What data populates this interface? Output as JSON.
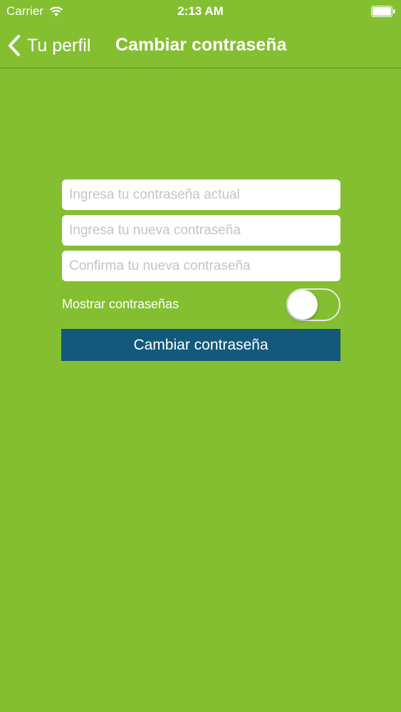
{
  "status_bar": {
    "carrier": "Carrier",
    "time": "2:13 AM",
    "wifi_icon": "wifi-icon",
    "battery_icon": "battery-icon"
  },
  "nav": {
    "back_label": "Tu perfil",
    "back_icon": "chevron-left-icon",
    "title": "Cambiar contraseña"
  },
  "form": {
    "current_password_placeholder": "Ingresa tu contraseña actual",
    "current_password_value": "",
    "new_password_placeholder": "Ingresa tu nueva contraseña",
    "new_password_value": "",
    "confirm_password_placeholder": "Confirma tu nueva contraseña",
    "confirm_password_value": "",
    "show_passwords_label": "Mostrar contraseñas",
    "show_passwords_on": false,
    "submit_label": "Cambiar contraseña"
  },
  "colors": {
    "background": "#84bf32",
    "button": "#13597b",
    "text": "#ffffff"
  }
}
